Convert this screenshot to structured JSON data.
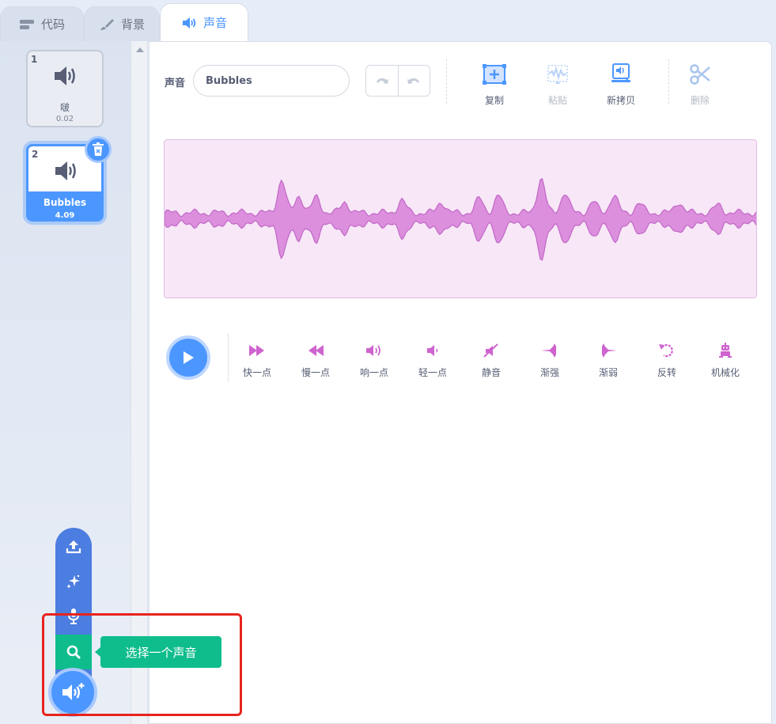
{
  "tabs": [
    {
      "label": "代码",
      "icon": "code-icon"
    },
    {
      "label": "背景",
      "icon": "brush-icon"
    },
    {
      "label": "声音",
      "icon": "sound-icon",
      "active": true
    }
  ],
  "sounds": [
    {
      "number": "1",
      "name": "啵",
      "duration": "0.02"
    },
    {
      "number": "2",
      "name": "Bubbles",
      "duration": "4.09",
      "selected": true
    }
  ],
  "editor": {
    "sound_label": "声音",
    "sound_name": "Bubbles",
    "tools": {
      "copy": "复制",
      "paste": "粘贴",
      "new_copy": "新拷贝",
      "delete": "删除"
    },
    "effects": [
      "快一点",
      "慢一点",
      "响一点",
      "轻一点",
      "静音",
      "渐强",
      "渐弱",
      "反转",
      "机械化"
    ]
  },
  "add_menu": {
    "tooltip": "选择一个声音",
    "items": [
      "upload-icon",
      "surprise-icon",
      "record-icon",
      "search-icon"
    ]
  },
  "colors": {
    "accent": "#4c97ff",
    "sound_effect": "#cf63cf",
    "waveform_fill": "#dc8fdc",
    "search_green": "#0fbd8c",
    "highlight_red": "#e8231e"
  }
}
